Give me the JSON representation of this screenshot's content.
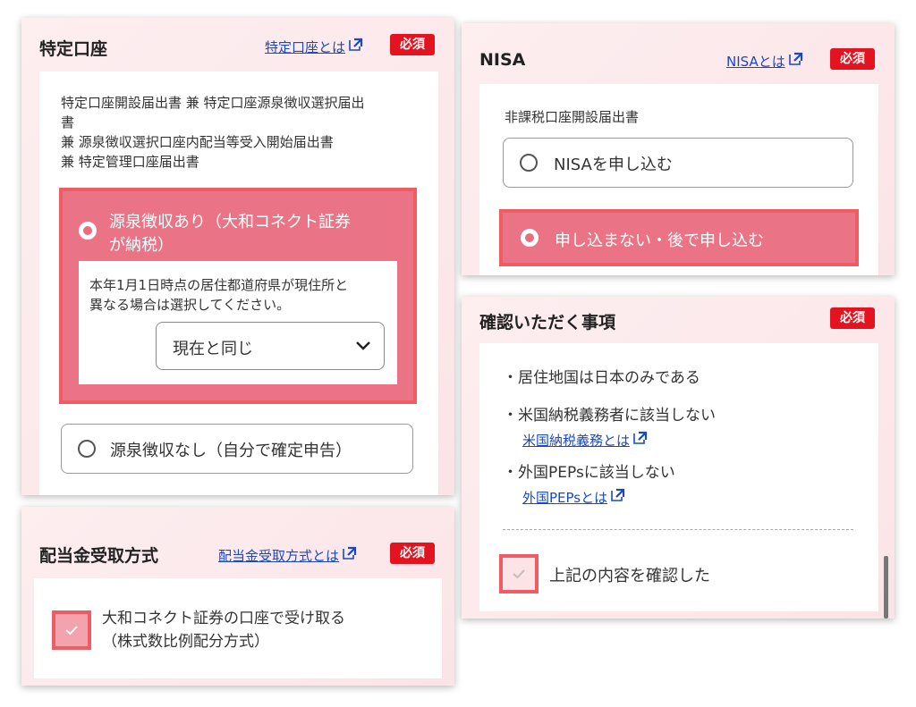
{
  "tokutei": {
    "title": "特定口座",
    "help_link": "特定口座とは",
    "required": "必須",
    "desc_lines": [
      "特定口座開設届出書 兼 特定口座源泉徴収選択届出",
      "書",
      "兼 源泉徴収選択口座内配当等受入開始届出書",
      "兼 特定管理口座届出書"
    ],
    "option_with": [
      "源泉徴収あり（大和コネクト証券",
      "が納税）"
    ],
    "note_lines": [
      "本年1月1日時点の居住都道府県が現住所と",
      "異なる場合は選択してください。"
    ],
    "prefecture_select": "現在と同じ",
    "option_without": "源泉徴収なし（自分で確定申告）"
  },
  "haito": {
    "title": "配当金受取方式",
    "help_link": "配当金受取方式とは",
    "required": "必須",
    "option_lines": [
      "大和コネクト証券の口座で受け取る",
      "（株式数比例配分方式）"
    ]
  },
  "nisa": {
    "title": "NISA",
    "help_link": "NISAとは",
    "required": "必須",
    "form_name": "非課税口座開設届出書",
    "option_apply": "NISAを申し込む",
    "option_later": "申し込まない・後で申し込む"
  },
  "kakunin": {
    "title": "確認いただく事項",
    "required": "必須",
    "items": [
      {
        "text": "・居住地国は日本のみである"
      },
      {
        "text": "・米国納税義務者に該当しない",
        "link": "米国納税義務とは"
      },
      {
        "text": "・外国PEPsに該当しない",
        "link": "外国PEPsとは"
      }
    ],
    "confirm_label": "上記の内容を確認した"
  },
  "icons": {
    "external": "external-link-icon",
    "check": "check-icon",
    "chevron": "chevron-down-icon"
  },
  "colors": {
    "required_badge": "#e3141f",
    "selected_fill": "#ea7486",
    "selected_border": "#f05c63",
    "link": "#1a48c4"
  }
}
